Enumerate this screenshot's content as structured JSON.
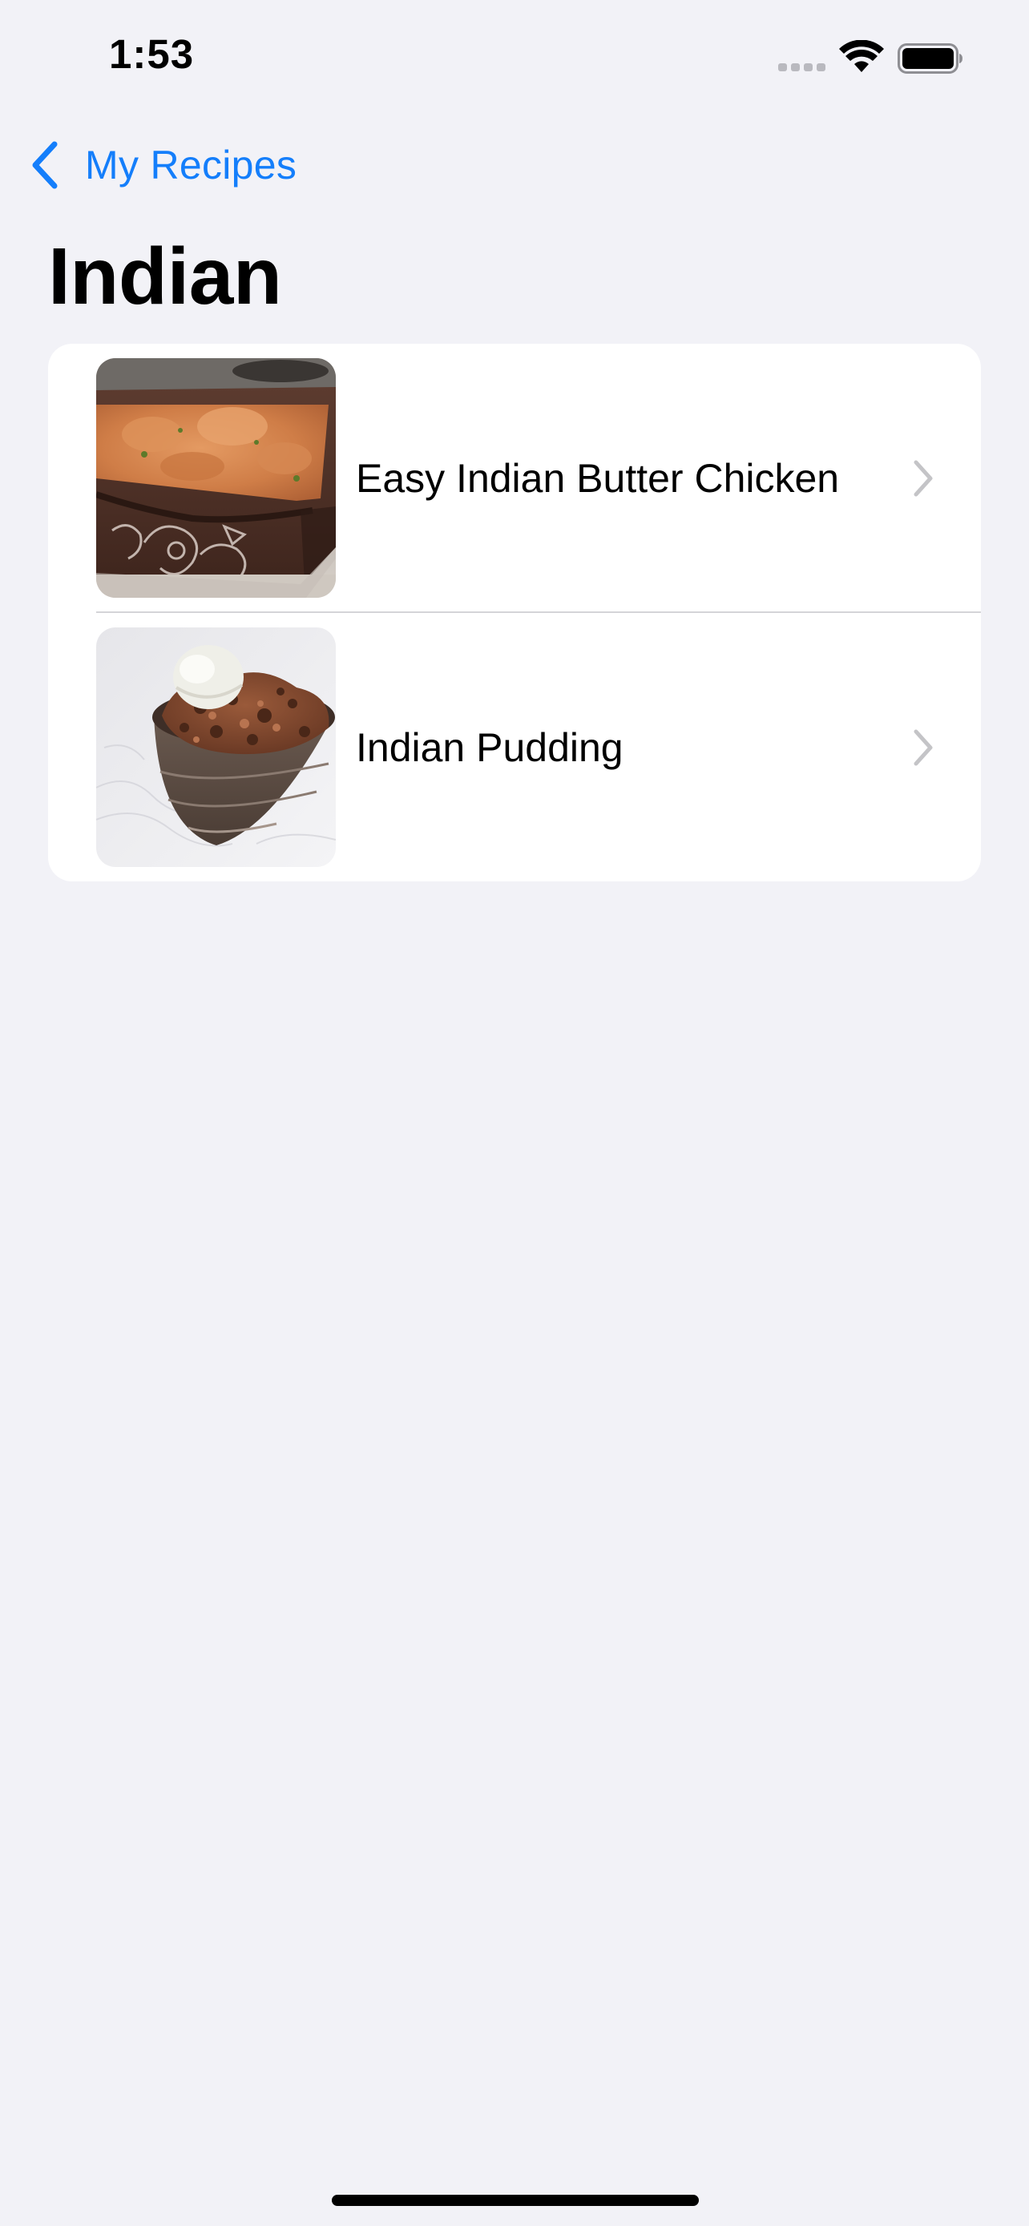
{
  "status_bar": {
    "time": "1:53",
    "signal_icon": "cellular-signal-icon",
    "wifi_icon": "wifi-icon",
    "battery_icon": "battery-icon"
  },
  "nav": {
    "back_icon": "chevron-left-icon",
    "back_label": "My Recipes",
    "accent_color": "#147efb"
  },
  "title": "Indian",
  "recipes": [
    {
      "name": "Easy Indian Butter Chicken",
      "thumbnail": "butter-chicken-photo",
      "chevron": "chevron-right-icon"
    },
    {
      "name": "Indian Pudding",
      "thumbnail": "indian-pudding-photo",
      "chevron": "chevron-right-icon"
    }
  ],
  "colors": {
    "background": "#f2f2f7",
    "card": "#ffffff",
    "separator": "#d4d4d8",
    "chevron": "#c4c4c7"
  }
}
